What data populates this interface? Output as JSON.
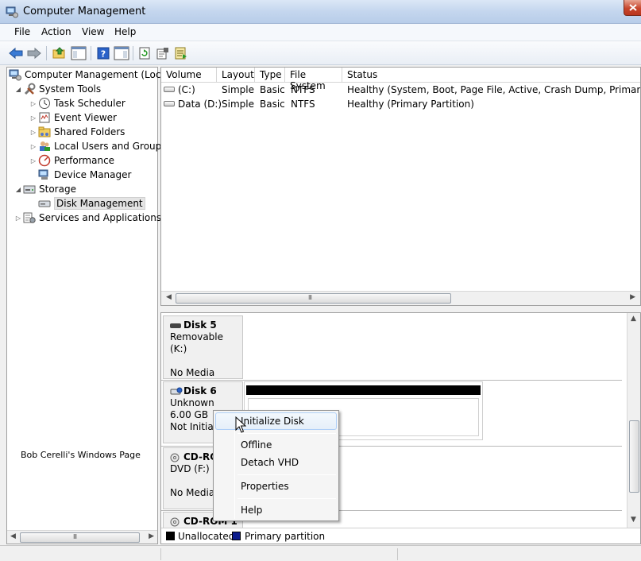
{
  "window": {
    "title": "Computer Management"
  },
  "menu": [
    "File",
    "Action",
    "View",
    "Help"
  ],
  "toolbar": {
    "buttons": [
      "back-arrow-icon",
      "forward-arrow-icon",
      "up-folder-icon",
      "show-hide-tree-icon",
      "help-icon",
      "show-hide-action-pane-icon",
      "refresh-icon",
      "properties-icon",
      "export-list-icon"
    ]
  },
  "tree": {
    "root": "Computer Management (Local",
    "system_tools": "System Tools",
    "task_scheduler": "Task Scheduler",
    "event_viewer": "Event Viewer",
    "shared_folders": "Shared Folders",
    "local_users": "Local Users and Groups",
    "performance": "Performance",
    "device_manager": "Device Manager",
    "storage": "Storage",
    "disk_management": "Disk Management",
    "services": "Services and Applications"
  },
  "scroll_grip": "III",
  "credit": "Bob Cerelli's Windows Page",
  "volumes": {
    "columns": [
      "Volume",
      "Layout",
      "Type",
      "File System",
      "Status"
    ],
    "rows": [
      [
        "(C:)",
        "Simple",
        "Basic",
        "NTFS",
        "Healthy (System, Boot, Page File, Active, Crash Dump, Primary Partit"
      ],
      [
        "Data (D:)",
        "Simple",
        "Basic",
        "NTFS",
        "Healthy (Primary Partition)"
      ]
    ]
  },
  "disks": {
    "disk5": {
      "name": "Disk 5",
      "line1": "Removable (K:)",
      "line2": "No Media"
    },
    "disk6": {
      "name": "Disk 6",
      "line1": "Unknown",
      "line2": "6.00 GB",
      "line3": "Not Initiali"
    },
    "cdrom0": {
      "name": "CD-RO",
      "line1": "DVD (F:)",
      "line2": "No Media"
    },
    "cdrom1": {
      "name": "CD-ROM 1"
    }
  },
  "legend": {
    "unallocated": "Unallocated",
    "primary": "Primary partition"
  },
  "colors": {
    "unallocated": "#000000",
    "primary": "#0a1a8c"
  },
  "context_menu": {
    "initialize": "Initialize Disk",
    "offline": "Offline",
    "detach": "Detach VHD",
    "properties": "Properties",
    "help": "Help"
  }
}
